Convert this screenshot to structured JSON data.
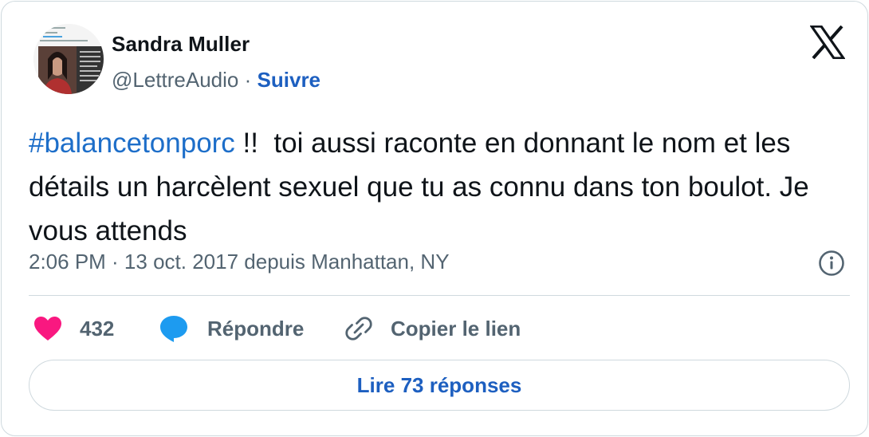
{
  "author": {
    "name": "Sandra Muller",
    "handle": "@LettreAudio",
    "separator": "·",
    "follow_label": "Suivre"
  },
  "tweet": {
    "hashtag": "#balancetonporc",
    "body": " !!  toi aussi raconte en donnant le nom et les détails un harcèlent sexuel que tu as connu dans ton boulot. Je vous attends",
    "meta": "2:06 PM · 13 oct. 2017 depuis Manhattan, NY"
  },
  "actions": {
    "like_count": "432",
    "reply_label": "Répondre",
    "copy_label": "Copier le lien"
  },
  "footer": {
    "read_replies_label": "Lire 73 réponses"
  },
  "colors": {
    "link_blue": "#1d5fc0",
    "hashtag_blue": "#1d6ec9",
    "like_pink": "#f91880",
    "reply_blue": "#1d9bf0",
    "secondary_text": "#536471",
    "border": "#cfd9de"
  },
  "icons": {
    "brand": "x-logo-icon",
    "info": "info-icon",
    "like": "heart-icon",
    "reply": "speech-bubble-icon",
    "copy": "link-icon"
  }
}
